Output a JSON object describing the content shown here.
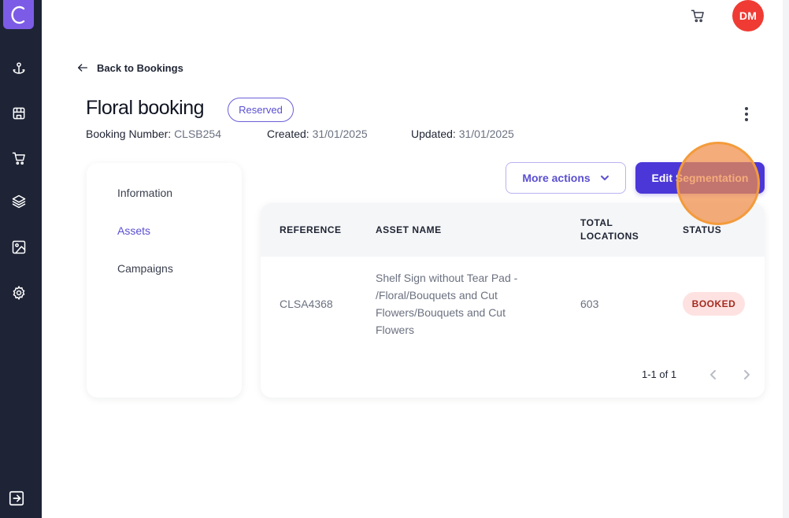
{
  "sidebar": {
    "logo_icon": "brand-c-logo",
    "items": [
      {
        "icon": "anchor-icon"
      },
      {
        "icon": "store-icon"
      },
      {
        "icon": "cart-icon"
      },
      {
        "icon": "layers-icon"
      },
      {
        "icon": "image-icon"
      },
      {
        "icon": "gear-icon"
      }
    ],
    "logout_icon": "logout-icon"
  },
  "header": {
    "cart_icon": "cart-icon",
    "avatar_initials": "DM",
    "avatar_color": "#ef3b33"
  },
  "back_link": "Back to Bookings",
  "booking": {
    "title": "Floral booking",
    "status": "Reserved",
    "number_label": "Booking Number:",
    "number": "CLSB254",
    "created_label": "Created:",
    "created": "31/01/2025",
    "updated_label": "Updated:",
    "updated": "31/01/2025"
  },
  "tabs": [
    {
      "label": "Information",
      "active": false
    },
    {
      "label": "Assets",
      "active": true
    },
    {
      "label": "Campaigns",
      "active": false
    }
  ],
  "actions": {
    "more_actions": "More actions",
    "edit_segmentation": "Edit Segmentation"
  },
  "table": {
    "columns": [
      "REFERENCE",
      "ASSET NAME",
      "TOTAL\nLOCATIONS",
      "STATUS"
    ],
    "rows": [
      {
        "reference": "CLSA4368",
        "asset_name": "Shelf Sign without Tear Pad - /Floral/Bouquets and Cut Flowers/Bouquets and Cut Flowers",
        "total_locations": "603",
        "status": "BOOKED"
      }
    ],
    "pagination": "1-1 of 1"
  },
  "colors": {
    "accent": "#4b37d8",
    "sidebar_bg": "#1e2436",
    "booked_bg": "#fde2e1",
    "highlight": "#f39b3b"
  }
}
